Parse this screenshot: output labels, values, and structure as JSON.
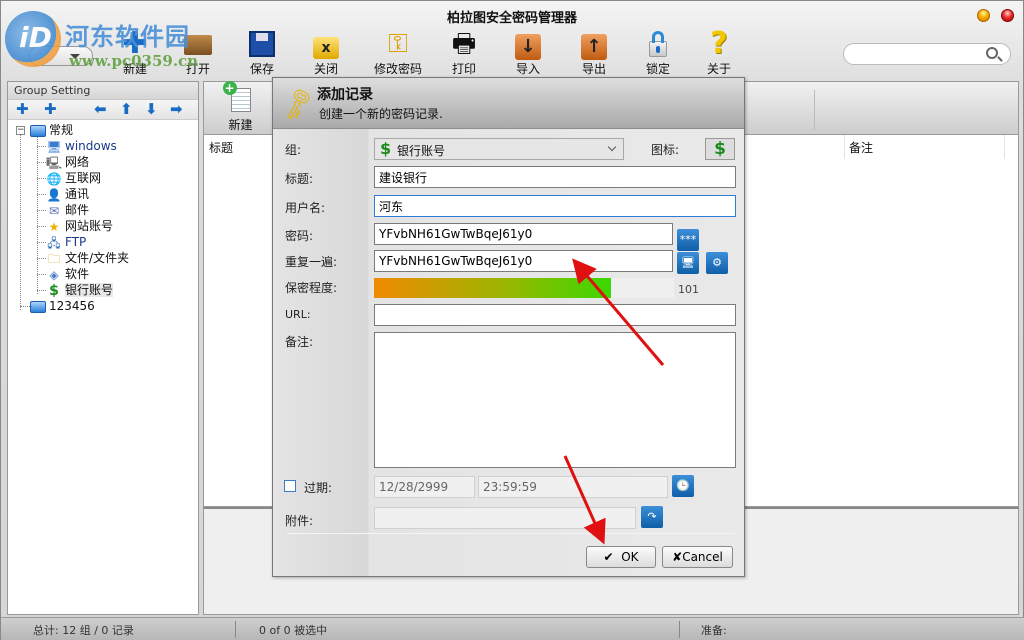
{
  "app": {
    "title": "柏拉图安全密码管理器",
    "watermark_text": "河东软件园",
    "watermark_url": "www.pc0359.cn"
  },
  "toolbar": {
    "items": [
      {
        "label": "新建",
        "icon": "new-database-icon"
      },
      {
        "label": "打开",
        "icon": "open-folder-icon"
      },
      {
        "label": "保存",
        "icon": "save-disk-icon"
      },
      {
        "label": "关闭",
        "icon": "close-folder-icon"
      },
      {
        "label": "修改密码",
        "icon": "change-password-keys-icon"
      },
      {
        "label": "打印",
        "icon": "printer-icon"
      },
      {
        "label": "导入",
        "icon": "import-icon"
      },
      {
        "label": "导出",
        "icon": "export-icon"
      },
      {
        "label": "锁定",
        "icon": "lock-icon"
      },
      {
        "label": "关于",
        "icon": "question-icon"
      }
    ],
    "search_value": ""
  },
  "left_panel": {
    "header": "Group Setting",
    "tree": {
      "root": "常规",
      "children": [
        {
          "label": "windows",
          "icon": "monitor-icon"
        },
        {
          "label": "网络",
          "icon": "network-computer-icon"
        },
        {
          "label": "互联网",
          "icon": "globe-icon"
        },
        {
          "label": "通讯",
          "icon": "contact-icon"
        },
        {
          "label": "邮件",
          "icon": "mail-icon"
        },
        {
          "label": "网站账号",
          "icon": "star-icon"
        },
        {
          "label": "FTP",
          "icon": "ftp-icon"
        },
        {
          "label": "文件/文件夹",
          "icon": "file-folder-icon"
        },
        {
          "label": "软件",
          "icon": "software-icon"
        },
        {
          "label": "银行账号",
          "icon": "dollar-icon",
          "selected": true
        }
      ],
      "second_root": "123456"
    }
  },
  "right_panel": {
    "new_label": "新建",
    "columns": [
      "标题",
      "备注"
    ]
  },
  "dialog": {
    "title": "添加记录",
    "subtitle": "创建一个新的密码记录.",
    "labels": {
      "group": "组:",
      "icon": "图标:",
      "title": "标题:",
      "username": "用户名:",
      "password": "密码:",
      "repeat": "重复一遍:",
      "strength": "保密程度:",
      "url": "URL:",
      "notes": "备注:",
      "expire": "过期:",
      "attachment": "附件:"
    },
    "group_value": "银行账号",
    "title_value": "建设银行",
    "username_value": "河东",
    "password_value": "YFvbNH61GwTwBqeJ61y0",
    "repeat_value": "YFvbNH61GwTwBqeJ61y0",
    "strength_value": 101,
    "strength_fill_fraction": 0.79,
    "url_value": "",
    "notes_value": "",
    "expire_checked": false,
    "expire_date": "12/28/2999",
    "expire_time": "23:59:59",
    "attachment_value": "",
    "ok_label": "OK",
    "cancel_label": "Cancel"
  },
  "statusbar": {
    "total": "总计: 12 组 / 0 记录",
    "selected": "0 of 0 被选中",
    "ready": "准备:"
  },
  "colors": {
    "accent_blue": "#1a6bc4",
    "dollar_green": "#1c8a1c",
    "annotation_red": "#e01010"
  }
}
